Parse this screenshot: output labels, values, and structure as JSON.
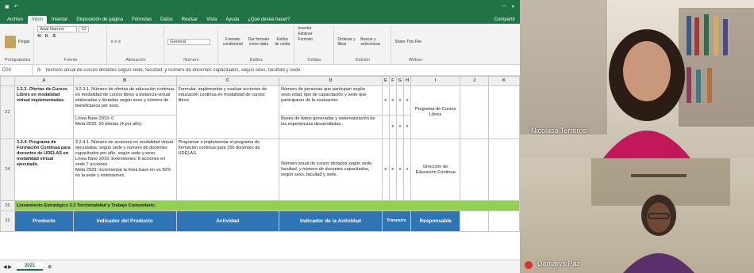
{
  "excel": {
    "tabs": [
      "Archivo",
      "Inicio",
      "Insertar",
      "Disposición de página",
      "Fórmulas",
      "Datos",
      "Revisar",
      "Vista",
      "Ayuda",
      "¿Qué desea hacer?"
    ],
    "share_label": "Compartir",
    "ribbon": {
      "paste": "Pegar",
      "clipboard": "Portapapeles",
      "font_name": "Arial Narrow",
      "font_size": "10",
      "font": "Fuente",
      "alignment": "Alineación",
      "number_format": "General",
      "number": "Número",
      "cond_format": "Formato condicional",
      "format_table": "Dar formato como tabla",
      "cell_styles": "Estilos de celda",
      "styles": "Estilos",
      "insert": "Insertar",
      "delete": "Eliminar",
      "format": "Formato",
      "cells": "Celdas",
      "sort": "Ordenar y filtrar",
      "find": "Buscar y seleccionar",
      "editing": "Edición",
      "share_this": "Share This File",
      "webex": "Webex"
    },
    "formula_bar": {
      "name_box": "D24",
      "formula": "Número anual de cursos dictados según sede, facultad, y número de docentes capacitados, según sexo, facultad y sede."
    },
    "columns": [
      "A",
      "B",
      "C",
      "D",
      "E",
      "F",
      "G",
      "H",
      "I",
      "J",
      "K"
    ],
    "rows": [
      {
        "num": "22",
        "a": "1.2.3. Ofertas de Cursos Libres en modalidad virtual implementadas.",
        "b": "3.2.3.1. Número de ofertas de educación continua en modalidad de cursos libres a distancia-virtual elaboradas y dictadas según sexo y número de beneficiarios por sexo.",
        "c": "Formular, implementar y evaluar acciones de educación continua en modalidad de cursos libres.",
        "d": "Número de personas que participan según sexo,edad, tipo de capacitación y sede que participaron de la evaluación.",
        "marks": [
          "x",
          "x",
          "x",
          "x"
        ],
        "i": "Programa de Cursos Libres"
      },
      {
        "num": "23",
        "b": "Línea Base 2019: 0\nMeta 2023: 20 ofertas (4 por año).",
        "d": "Bases de datos generadas y sistematización de las experiencias desarrolladas.",
        "marks": [
          "",
          "x",
          "x",
          "x"
        ]
      },
      {
        "num": "24",
        "a": "3.2.4. Programa de Formación Continua para docentes de UDELAS en modalidad virtual ejecutado.",
        "b": "3.2.4.1. Número de acciones en modalidad virtual ejecutadas, según sede y número de docentes capacitados por año, según sede y sexo.\nLínea Base 2019: Extensiones: 8 acciones en sede 7 acciones.\nMeta 2023: incrementar la línea base en un 50% en la sede y extensiones.",
        "c": "Programar e implementar el programa de formación continua para 150 docentes de UDELAS.",
        "d": "Número anual de cursos dictados según sede, facultad, y número de docentes capacitados, según sexo, facultad y sede.",
        "marks": [
          "x",
          "x",
          "x",
          "x"
        ],
        "i": "Dirección de Educación Continua"
      }
    ],
    "band_row": {
      "num": "25",
      "text": "Lineamiento Estratégico 3.3 Territorialidad y Trabajo Comunitario."
    },
    "header_row": {
      "num": "26",
      "producto": "Producto",
      "indicador_producto": "Indicador del Producto",
      "actividad": "Actividad",
      "indicador_actividad": "Indicador de la Actividad",
      "trimestre": "Trimestre",
      "responsable": "Responsable"
    },
    "sheet_tab": "2021"
  },
  "participants": [
    {
      "name": "Nicolasa Terreros"
    },
    {
      "name": "Damarys Paz"
    }
  ]
}
